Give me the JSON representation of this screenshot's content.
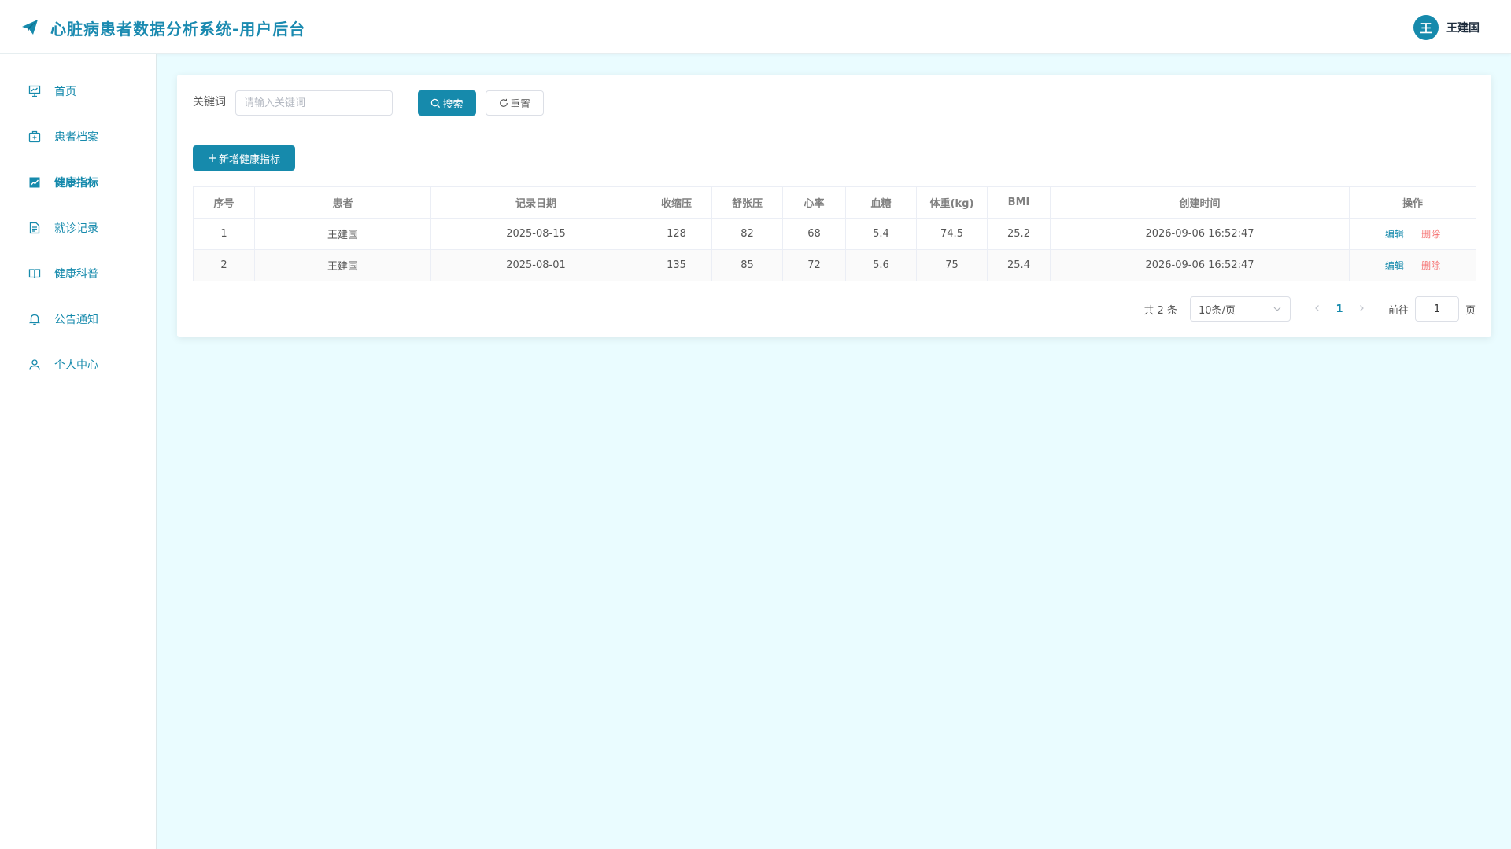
{
  "header": {
    "title": "心脏病患者数据分析系统-用户后台",
    "avatar_letter": "王",
    "user_name": "王建国"
  },
  "sidebar": {
    "items": [
      {
        "label": "首页",
        "icon": "chart-board-icon"
      },
      {
        "label": "患者档案",
        "icon": "medical-box-icon"
      },
      {
        "label": "健康指标",
        "icon": "trend-chart-icon",
        "active": true
      },
      {
        "label": "就诊记录",
        "icon": "document-icon"
      },
      {
        "label": "健康科普",
        "icon": "book-icon"
      },
      {
        "label": "公告通知",
        "icon": "bell-icon"
      },
      {
        "label": "个人中心",
        "icon": "user-icon"
      }
    ]
  },
  "search": {
    "label": "关键词",
    "placeholder": "请输入关键词",
    "value": "",
    "search_button": "搜索",
    "reset_button": "重置"
  },
  "add_button": "新增健康指标",
  "table": {
    "columns": [
      "序号",
      "患者",
      "记录日期",
      "收缩压",
      "舒张压",
      "心率",
      "血糖",
      "体重(kg)",
      "BMI",
      "创建时间",
      "操作"
    ],
    "rows": [
      {
        "no": "1",
        "patient": "王建国",
        "date": "2025-08-15",
        "systolic": "128",
        "diastolic": "82",
        "heart_rate": "68",
        "glucose": "5.4",
        "weight": "74.5",
        "bmi": "25.2",
        "created": "2026-09-06 16:52:47",
        "edit": "编辑",
        "delete": "删除"
      },
      {
        "no": "2",
        "patient": "王建国",
        "date": "2025-08-01",
        "systolic": "135",
        "diastolic": "85",
        "heart_rate": "72",
        "glucose": "5.6",
        "weight": "75",
        "bmi": "25.4",
        "created": "2026-09-06 16:52:47",
        "edit": "编辑",
        "delete": "删除"
      }
    ]
  },
  "pagination": {
    "total": "共 2 条",
    "page_size": "10条/页",
    "current_page": "1",
    "goto_label": "前往",
    "goto_value": "1",
    "page_suffix": "页"
  },
  "colors": {
    "primary": "#168aac",
    "danger": "#f56c6c",
    "background": "#eafcff"
  }
}
